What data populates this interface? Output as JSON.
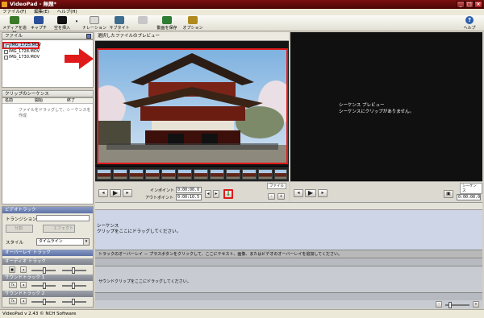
{
  "window": {
    "title": "VideoPad - 無題*",
    "minimize": "_",
    "maximize": "□",
    "close": "×"
  },
  "menu": [
    "ファイル(F)",
    "編集(E)",
    "ヘルプ(H)"
  ],
  "toolbar": {
    "items": [
      {
        "label": "メディアを追加",
        "color": "#3c7a2a"
      },
      {
        "label": "キャプチャ",
        "color": "#2a4f9a"
      },
      {
        "label": "空を挿入",
        "color": "#111111"
      },
      {
        "label": "ナレーション",
        "color": "#5a5a5a"
      },
      {
        "label": "サブタイトル",
        "color": "#3d6d8f"
      },
      {
        "label": "",
        "color": "#c7c7c7"
      },
      {
        "label": "動画を保存",
        "color": "#2e7d32"
      },
      {
        "label": "オプション",
        "color": "#b08a1e"
      }
    ],
    "help_label": "ヘルプ",
    "help_symbol": "?"
  },
  "files_panel": {
    "title": "ファイル",
    "items": [
      "IMG_1725.MOV",
      "IMG_1728.MOV",
      "IMG_1730.MOV"
    ]
  },
  "clips_panel": {
    "title": "クリップのシーケンス",
    "columns": [
      "名前",
      "開始",
      "終了"
    ],
    "hint": "ファイルをドラッグして、シーケンスを作成"
  },
  "preview": {
    "header": "選択したファイルのプレビュー",
    "sequence_title": "シーケンス プレビュー",
    "sequence_msg": "シーケンスにクリップがありません。"
  },
  "controls": {
    "in_label": "インポイント",
    "in_value": "0:00:00.0",
    "out_label": "アウトポイント",
    "out_value": "0:00:10.5",
    "file_tab": "ファイル",
    "seq_tab": "シーケンス",
    "seq_time": "0:00:00.0",
    "add_arrow": "⇓"
  },
  "effects": {
    "video_track": "ビデオトラック",
    "transition_label": "トランジション",
    "split_btn": "分割",
    "effect_btn": "エフェクト",
    "style_label": "スタイル",
    "style_value": "タイムライン",
    "overlay_track": "オーバーレイ トラック",
    "audio_track": "オーディオ トラック",
    "sound_track1": "サウンドトラック 1",
    "sound_track2": "サウンドトラック 2"
  },
  "timeline": {
    "sequence_label": "シーケンス",
    "drag_clip": "クリップをここにドラッグしてください。",
    "overlay_msg": "トラックのオーバーレイ － プラスボタンをクリックして、ここにテキスト、画像、またはビデオのオーバーレイを追加してください。",
    "sound_msg": "サウンドクリップをここにドラッグしてください。"
  },
  "status": "VideoPad v 2.43 © NCH Software"
}
